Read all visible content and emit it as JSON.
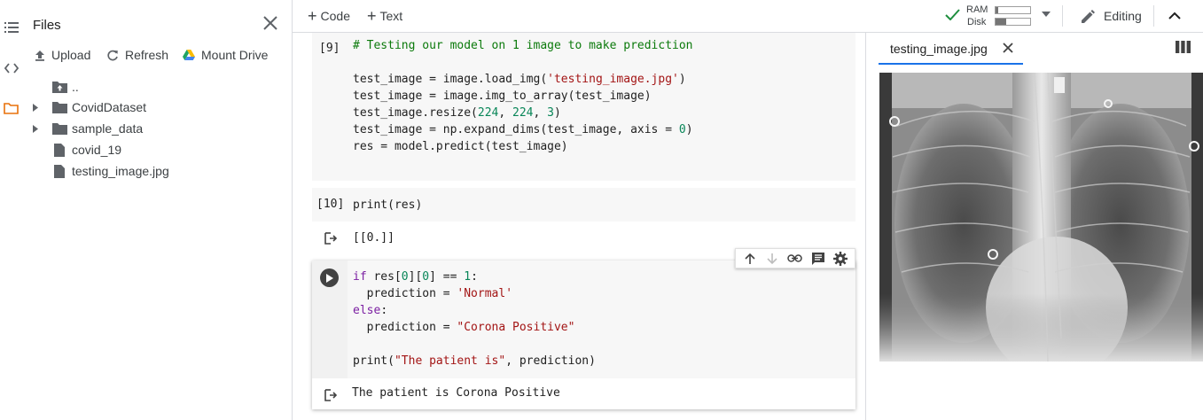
{
  "files_panel": {
    "title": "Files",
    "actions": [
      {
        "label": "Upload",
        "icon": "upload-icon"
      },
      {
        "label": "Refresh",
        "icon": "refresh-icon"
      },
      {
        "label": "Mount Drive",
        "icon": "google-drive-icon"
      }
    ],
    "tree": [
      {
        "label": "..",
        "type": "parent-folder"
      },
      {
        "label": "CovidDataset",
        "type": "folder"
      },
      {
        "label": "sample_data",
        "type": "folder"
      },
      {
        "label": "covid_19",
        "type": "file"
      },
      {
        "label": "testing_image.jpg",
        "type": "file"
      }
    ]
  },
  "toolbar": {
    "code_label": "Code",
    "text_label": "Text",
    "ram_label": "RAM",
    "disk_label": "Disk",
    "ram_usage": 0.08,
    "disk_usage": 0.3,
    "editing_label": "Editing"
  },
  "cells": [
    {
      "exec_count": "[9]",
      "lines": [
        "# Testing our model on 1 image to make prediction",
        "",
        "test_image = image.load_img('testing_image.jpg')",
        "test_image = image.img_to_array(test_image)",
        "test_image.resize(224, 224, 3)",
        "test_image = np.expand_dims(test_image, axis = 0)",
        "res = model.predict(test_image)"
      ]
    },
    {
      "exec_count": "[10]",
      "lines": [
        "print(res)"
      ],
      "output": "[[0.]]"
    },
    {
      "exec_count": "",
      "lines": [
        "if res[0][0] == 1:",
        "  prediction = 'Normal'",
        "else:",
        "  prediction = \"Corona Positive\"",
        "",
        "print(\"The patient is\", prediction)"
      ],
      "output": "The patient is Corona Positive"
    }
  ],
  "viewer": {
    "tab_label": "testing_image.jpg",
    "image_alt": "chest x-ray"
  },
  "colors": {
    "accent_blue": "#1a73e8",
    "check_green": "#1e8e3e",
    "folder_orange": "#e8710a",
    "keyword_purple": "#7b1fa2",
    "string_red": "#a31515",
    "number_green": "#098658",
    "comment_green": "#0b7a0b"
  }
}
